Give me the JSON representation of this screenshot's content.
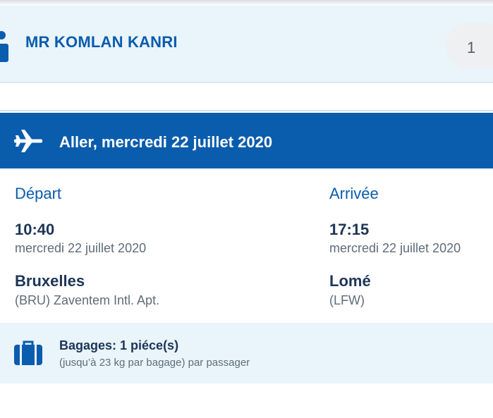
{
  "passenger": {
    "name": "MR KOMLAN KANRI",
    "count": "1",
    "icon": "person-icon"
  },
  "flight": {
    "icon": "airplane-icon",
    "title": "Aller, mercredi 22 juillet 2020",
    "departure": {
      "label": "Départ",
      "time": "10:40",
      "date": "mercredi 22 juillet 2020",
      "city": "Bruxelles",
      "airport": "(BRU) Zaventem Intl. Apt."
    },
    "arrival": {
      "label": "Arrivée",
      "time": "17:15",
      "date": "mercredi 22 juillet 2020",
      "city": "Lomé",
      "airport": "(LFW)"
    },
    "baggage": {
      "icon": "suitcase-icon",
      "title": "Bagages: 1 piéce(s)",
      "subtitle": "(jusqu’à 23 kg par bagage) par passager"
    }
  },
  "colors": {
    "primary": "#0a5cad",
    "light_band": "#e9f4fb",
    "text_dark": "#1d3557",
    "text_muted": "#5f6c78"
  }
}
